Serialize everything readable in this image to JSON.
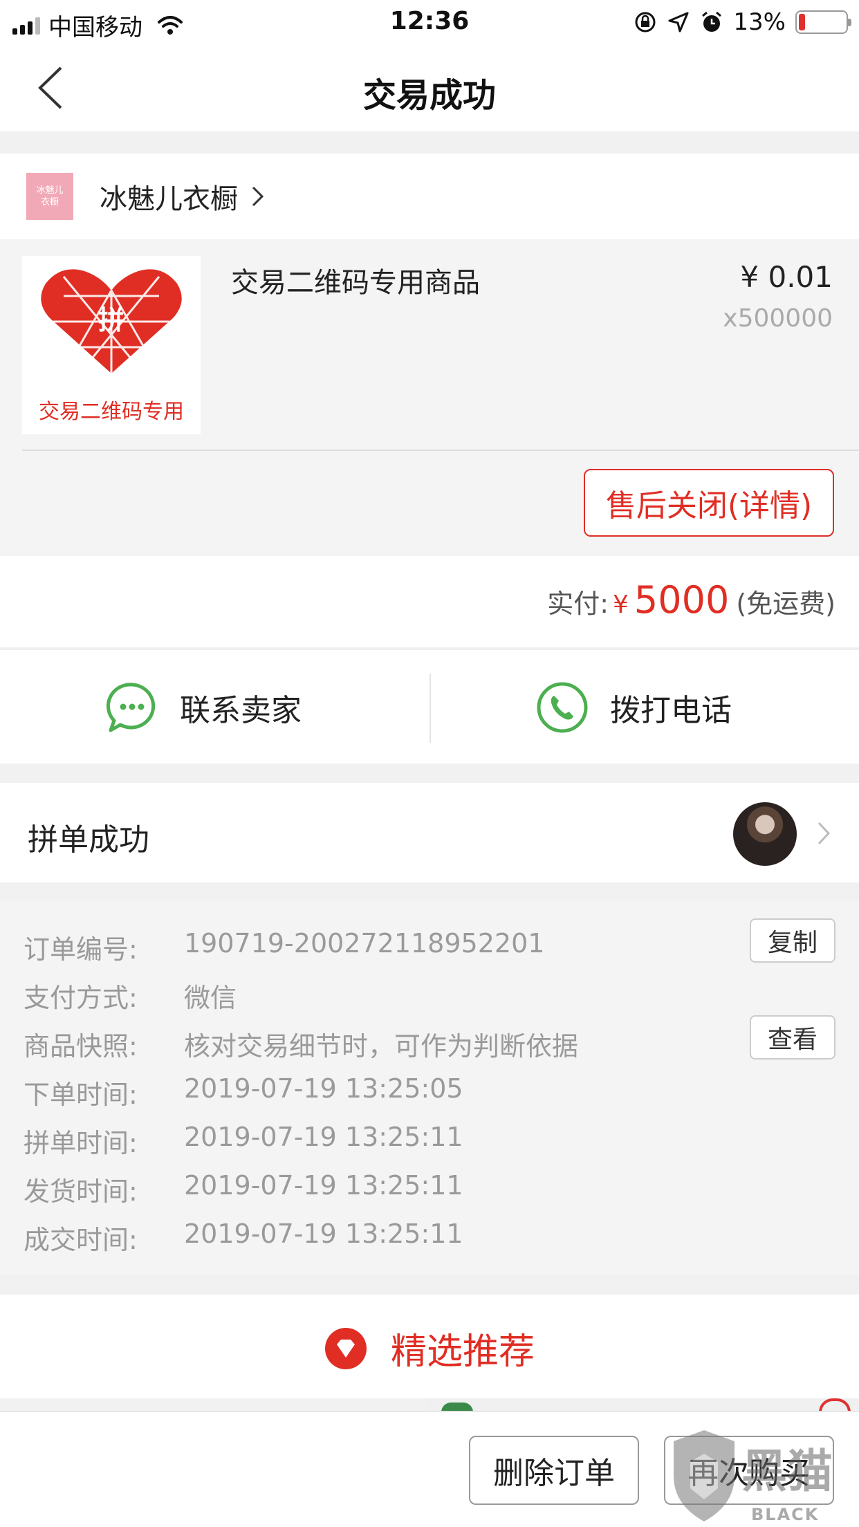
{
  "status_bar": {
    "carrier": "中国移动",
    "time": "12:36",
    "battery_percent": "13%",
    "battery_level": 0.13,
    "signal_bars": 4,
    "signal_bars_filled": 3
  },
  "nav": {
    "back_icon": "chevron-left-icon",
    "title": "交易成功"
  },
  "shop": {
    "logo_text": "冰魅儿\n衣橱",
    "name": "冰魅儿衣橱"
  },
  "product": {
    "thumb_caption": "交易二维码专用",
    "thumb_center_char": "拼",
    "name": "交易二维码专用商品",
    "price": "¥ 0.01",
    "quantity": "x500000",
    "after_sale_button": "售后关闭(详情)"
  },
  "payment": {
    "label": "实付:",
    "currency": "¥",
    "amount": "5000",
    "note": "(免运费)"
  },
  "contact": {
    "seller_label": "联系卖家",
    "phone_label": "拨打电话"
  },
  "group": {
    "label": "拼单成功"
  },
  "details": {
    "rows": [
      {
        "key": "订单编号:",
        "value": "190719-200272118952201"
      },
      {
        "key": "支付方式:",
        "value": "微信"
      },
      {
        "key": "商品快照:",
        "value": "核对交易细节时，可作为判断依据"
      },
      {
        "key": "下单时间:",
        "value": "2019-07-19 13:25:05"
      },
      {
        "key": "拼单时间:",
        "value": "2019-07-19 13:25:11"
      },
      {
        "key": "发货时间:",
        "value": "2019-07-19 13:25:11"
      },
      {
        "key": "成交时间:",
        "value": "2019-07-19 13:25:11"
      }
    ],
    "copy_button": "复制",
    "view_button": "查看"
  },
  "recommend": {
    "label": "精选推荐"
  },
  "bottom": {
    "delete_button": "删除订单",
    "rebuy_button": "再次购买"
  },
  "watermark": {
    "big_text": "黑猫",
    "small_text": "BLACK CAT"
  },
  "colors": {
    "accent_red": "#e02e24",
    "wechat_green": "#4caf50"
  }
}
